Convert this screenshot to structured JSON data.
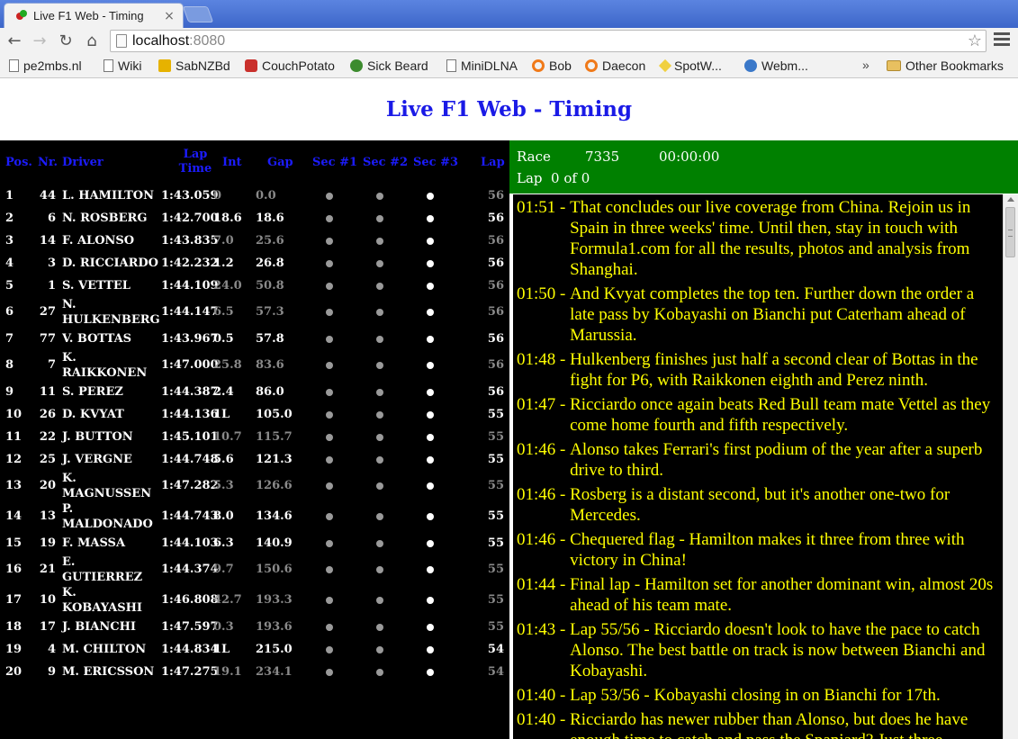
{
  "browser": {
    "tab_title": "Live F1 Web - Timing",
    "tab_close": "×",
    "url_host": "localhost",
    "url_port": ":8080",
    "bookmarks": [
      {
        "label": "pe2mbs.nl",
        "icon": "page-icon"
      },
      {
        "label": "Wiki",
        "icon": "page-icon"
      },
      {
        "label": "SabNZBd",
        "icon": "sabnzbd-icon"
      },
      {
        "label": "CouchPotato",
        "icon": "couchpotato-icon"
      },
      {
        "label": "Sick Beard",
        "icon": "sickbeard-icon"
      },
      {
        "label": "MiniDLNA",
        "icon": "page-icon"
      },
      {
        "label": "Bob",
        "icon": "ring-icon"
      },
      {
        "label": "Daecon",
        "icon": "ring-icon"
      },
      {
        "label": "SpotW...",
        "icon": "spotweb-icon"
      },
      {
        "label": "Webm...",
        "icon": "webmin-icon"
      }
    ],
    "more_label": "»",
    "other_bookmarks": "Other Bookmarks"
  },
  "page": {
    "title": "Live F1 Web - Timing"
  },
  "timing": {
    "headers": {
      "pos": "Pos.",
      "nr": "Nr.",
      "driver": "Driver",
      "lap_time": "Lap Time",
      "int": "Int",
      "gap": "Gap",
      "sec1": "Sec #1",
      "sec2": "Sec #2",
      "sec3": "Sec #3",
      "lap": "Lap"
    },
    "rows": [
      {
        "pos": "1",
        "nr": "44",
        "driver": "L. HAMILTON",
        "lap_time": "1:43.059",
        "int": "0",
        "gap": "0.0",
        "lap": "56",
        "muted": true
      },
      {
        "pos": "2",
        "nr": "6",
        "driver": "N. ROSBERG",
        "lap_time": "1:42.700",
        "int": "18.6",
        "gap": "18.6",
        "lap": "56",
        "muted": false
      },
      {
        "pos": "3",
        "nr": "14",
        "driver": "F. ALONSO",
        "lap_time": "1:43.835",
        "int": "7.0",
        "gap": "25.6",
        "lap": "56",
        "muted": true
      },
      {
        "pos": "4",
        "nr": "3",
        "driver": "D. RICCIARDO",
        "lap_time": "1:42.232",
        "int": "1.2",
        "gap": "26.8",
        "lap": "56",
        "muted": false
      },
      {
        "pos": "5",
        "nr": "1",
        "driver": "S. VETTEL",
        "lap_time": "1:44.109",
        "int": "24.0",
        "gap": "50.8",
        "lap": "56",
        "muted": true
      },
      {
        "pos": "6",
        "nr": "27",
        "driver": "N. HULKENBERG",
        "lap_time": "1:44.147",
        "int": "6.5",
        "gap": "57.3",
        "lap": "56",
        "muted": true
      },
      {
        "pos": "7",
        "nr": "77",
        "driver": "V. BOTTAS",
        "lap_time": "1:43.967",
        "int": "0.5",
        "gap": "57.8",
        "lap": "56",
        "muted": false
      },
      {
        "pos": "8",
        "nr": "7",
        "driver": "K. RAIKKONEN",
        "lap_time": "1:47.000",
        "int": "25.8",
        "gap": "83.6",
        "lap": "56",
        "muted": true
      },
      {
        "pos": "9",
        "nr": "11",
        "driver": "S. PEREZ",
        "lap_time": "1:44.387",
        "int": "2.4",
        "gap": "86.0",
        "lap": "56",
        "muted": false
      },
      {
        "pos": "10",
        "nr": "26",
        "driver": "D. KVYAT",
        "lap_time": "1:44.136",
        "int": "1L",
        "gap": "105.0",
        "lap": "55",
        "muted": false
      },
      {
        "pos": "11",
        "nr": "22",
        "driver": "J. BUTTON",
        "lap_time": "1:45.101",
        "int": "10.7",
        "gap": "115.7",
        "lap": "55",
        "muted": true
      },
      {
        "pos": "12",
        "nr": "25",
        "driver": "J. VERGNE",
        "lap_time": "1:44.748",
        "int": "5.6",
        "gap": "121.3",
        "lap": "55",
        "muted": false
      },
      {
        "pos": "13",
        "nr": "20",
        "driver": "K. MAGNUSSEN",
        "lap_time": "1:47.282",
        "int": "5.3",
        "gap": "126.6",
        "lap": "55",
        "muted": true
      },
      {
        "pos": "14",
        "nr": "13",
        "driver": "P. MALDONADO",
        "lap_time": "1:44.743",
        "int": "8.0",
        "gap": "134.6",
        "lap": "55",
        "muted": false
      },
      {
        "pos": "15",
        "nr": "19",
        "driver": "F. MASSA",
        "lap_time": "1:44.103",
        "int": "6.3",
        "gap": "140.9",
        "lap": "55",
        "muted": false
      },
      {
        "pos": "16",
        "nr": "21",
        "driver": "E. GUTIERREZ",
        "lap_time": "1:44.374",
        "int": "9.7",
        "gap": "150.6",
        "lap": "55",
        "muted": true
      },
      {
        "pos": "17",
        "nr": "10",
        "driver": "K. KOBAYASHI",
        "lap_time": "1:46.808",
        "int": "42.7",
        "gap": "193.3",
        "lap": "55",
        "muted": true
      },
      {
        "pos": "18",
        "nr": "17",
        "driver": "J. BIANCHI",
        "lap_time": "1:47.597",
        "int": "0.3",
        "gap": "193.6",
        "lap": "55",
        "muted": true
      },
      {
        "pos": "19",
        "nr": "4",
        "driver": "M. CHILTON",
        "lap_time": "1:44.834",
        "int": "1L",
        "gap": "215.0",
        "lap": "54",
        "muted": false
      },
      {
        "pos": "20",
        "nr": "9",
        "driver": "M. ERICSSON",
        "lap_time": "1:47.275",
        "int": "19.1",
        "gap": "234.1",
        "lap": "54",
        "muted": true
      }
    ]
  },
  "status": {
    "session": "Race",
    "event_id": "7335",
    "clock": "00:00:00",
    "lap_text": "Lap  0 of 0"
  },
  "commentary": [
    {
      "time": "01:51",
      "text": "That concludes our live coverage from China. Rejoin us in Spain in three weeks' time. Until then, stay in touch with Formula1.com for all the results, photos and analysis from Shanghai."
    },
    {
      "time": "01:50",
      "text": "And Kvyat completes the top ten. Further down the order a late pass by Kobayashi on Bianchi put Caterham ahead of Marussia."
    },
    {
      "time": "01:48",
      "text": "Hulkenberg finishes just half a second clear of Bottas in the fight for P6, with Raikkonen eighth and Perez ninth."
    },
    {
      "time": "01:47",
      "text": "Ricciardo once again beats Red Bull team mate Vettel as they come home fourth and fifth respectively."
    },
    {
      "time": "01:46",
      "text": "Alonso takes Ferrari's first podium of the year after a superb drive to third."
    },
    {
      "time": "01:46",
      "text": "Rosberg is a distant second, but it's another one-two for Mercedes."
    },
    {
      "time": "01:46",
      "text": "Chequered flag - Hamilton makes it three from three with victory in China!"
    },
    {
      "time": "01:44",
      "text": "Final lap - Hamilton set for another dominant win, almost 20s ahead of his team mate."
    },
    {
      "time": "01:43",
      "text": "Lap 55/56 - Ricciardo doesn't look to have the pace to catch Alonso. The best battle on track is now between Bianchi and Kobayashi."
    },
    {
      "time": "01:40",
      "text": "Lap 53/56 - Kobayashi closing in on Bianchi for 17th."
    },
    {
      "time": "01:40",
      "text": "Ricciardo has newer rubber than Alonso, but does he have enough time to catch and pass the Spaniard? Just three"
    }
  ]
}
